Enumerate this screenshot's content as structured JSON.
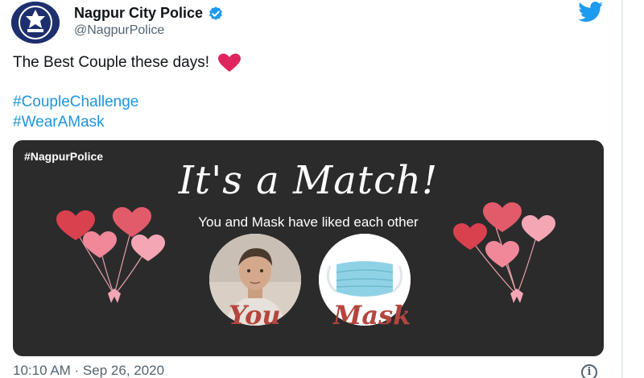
{
  "author": {
    "display_name": "Nagpur City Police",
    "handle": "@NagpurPolice",
    "verified": true
  },
  "tweet": {
    "text": "The Best Couple these days!",
    "emoji": "heart",
    "hashtags": [
      "#CoupleChallenge",
      "#WearAMask"
    ]
  },
  "media": {
    "tag": "#NagpurPolice",
    "title": "It's a Match!",
    "subtitle": "You and Mask have liked each other",
    "left_label": "You",
    "right_label": "Mask"
  },
  "meta": {
    "timestamp": "10:10 AM · Sep 26, 2020",
    "info_glyph": "i"
  },
  "colors": {
    "link": "#1b95e0",
    "verified": "#1d9bf0",
    "heart": "#e0245e",
    "media_bg": "#2b2b2b",
    "label_red": "#b4463e"
  },
  "icons": [
    "verified-badge-icon",
    "twitter-bird-icon",
    "heart-emoji-icon",
    "info-icon"
  ]
}
